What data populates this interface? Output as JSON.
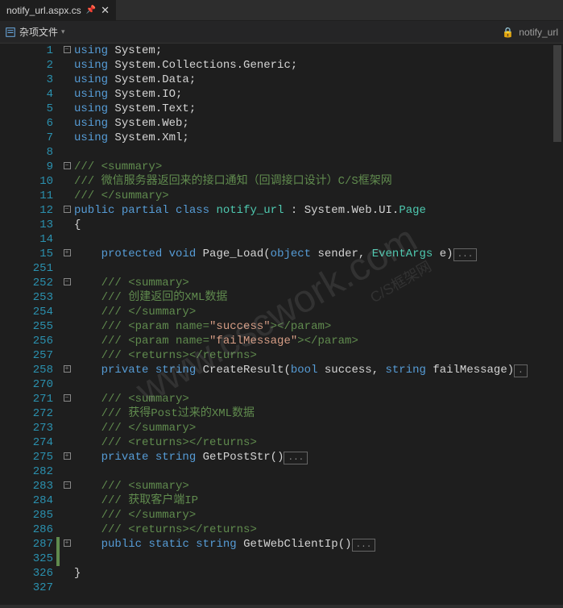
{
  "tab": {
    "title": "notify_url.aspx.cs"
  },
  "subbar": {
    "misc": "杂项文件",
    "right": "notify_url"
  },
  "watermark": "www.cscwork.com",
  "watermark_sub": "C/S框架网",
  "lines": [
    {
      "n": "1",
      "fold": "-",
      "html": "<span class='kw'>using</span> System;"
    },
    {
      "n": "2",
      "fold": "",
      "html": "<span class='kw'>using</span> System.Collections.Generic;"
    },
    {
      "n": "3",
      "fold": "",
      "html": "<span class='kw'>using</span> System.Data;"
    },
    {
      "n": "4",
      "fold": "",
      "html": "<span class='kw'>using</span> System.IO;"
    },
    {
      "n": "5",
      "fold": "",
      "html": "<span class='kw'>using</span> System.Text;"
    },
    {
      "n": "6",
      "fold": "",
      "html": "<span class='kw'>using</span> System.Web;"
    },
    {
      "n": "7",
      "fold": "",
      "html": "<span class='kw'>using</span> System.Xml;"
    },
    {
      "n": "8",
      "fold": "",
      "html": ""
    },
    {
      "n": "9",
      "fold": "-",
      "html": "<span class='comment'>/// &lt;summary&gt;</span>"
    },
    {
      "n": "10",
      "fold": "",
      "html": "<span class='comment'>/// 微信服务器返回来的接口通知（回调接口设计）C/S框架网</span>"
    },
    {
      "n": "11",
      "fold": "",
      "html": "<span class='comment'>/// &lt;/summary&gt;</span>"
    },
    {
      "n": "12",
      "fold": "-",
      "html": "<span class='kw'>public</span> <span class='kw'>partial</span> <span class='kw'>class</span> <span class='type'>notify_url</span> : System.Web.UI.<span class='type'>Page</span>"
    },
    {
      "n": "13",
      "fold": "",
      "html": "{"
    },
    {
      "n": "14",
      "fold": "",
      "html": ""
    },
    {
      "n": "15",
      "fold": "+",
      "html": "    <span class='kw'>protected</span> <span class='kw'>void</span> Page_Load(<span class='kw'>object</span> sender, <span class='type'>EventArgs</span> e)<span class='collapsed-box'>...</span>"
    },
    {
      "n": "251",
      "fold": "",
      "html": ""
    },
    {
      "n": "252",
      "fold": "-",
      "html": "    <span class='comment'>/// &lt;summary&gt;</span>"
    },
    {
      "n": "253",
      "fold": "",
      "html": "    <span class='comment'>/// 创建返回的XML数据</span>"
    },
    {
      "n": "254",
      "fold": "",
      "html": "    <span class='comment'>/// &lt;/summary&gt;</span>"
    },
    {
      "n": "255",
      "fold": "",
      "html": "    <span class='comment'>/// &lt;param name=</span><span class='str'>\"success\"</span><span class='comment'>&gt;&lt;/param&gt;</span>"
    },
    {
      "n": "256",
      "fold": "",
      "html": "    <span class='comment'>/// &lt;param name=</span><span class='str'>\"failMessage\"</span><span class='comment'>&gt;&lt;/param&gt;</span>"
    },
    {
      "n": "257",
      "fold": "",
      "html": "    <span class='comment'>/// &lt;returns&gt;&lt;/returns&gt;</span>"
    },
    {
      "n": "258",
      "fold": "+",
      "html": "    <span class='kw'>private</span> <span class='kw'>string</span> CreateResult(<span class='kw'>bool</span> success, <span class='kw'>string</span> failMessage)<span class='collapsed-box'>.</span>"
    },
    {
      "n": "270",
      "fold": "",
      "html": ""
    },
    {
      "n": "271",
      "fold": "-",
      "html": "    <span class='comment'>/// &lt;summary&gt;</span>"
    },
    {
      "n": "272",
      "fold": "",
      "html": "    <span class='comment'>/// 获得Post过来的XML数据</span>"
    },
    {
      "n": "273",
      "fold": "",
      "html": "    <span class='comment'>/// &lt;/summary&gt;</span>"
    },
    {
      "n": "274",
      "fold": "",
      "html": "    <span class='comment'>/// &lt;returns&gt;&lt;/returns&gt;</span>"
    },
    {
      "n": "275",
      "fold": "+",
      "html": "    <span class='kw'>private</span> <span class='kw'>string</span> GetPostStr()<span class='collapsed-box'>...</span>"
    },
    {
      "n": "282",
      "fold": "",
      "html": ""
    },
    {
      "n": "283",
      "fold": "-",
      "html": "    <span class='comment'>/// &lt;summary&gt;</span>"
    },
    {
      "n": "284",
      "fold": "",
      "html": "    <span class='comment'>/// 获取客户端IP</span>"
    },
    {
      "n": "285",
      "fold": "",
      "html": "    <span class='comment'>/// &lt;/summary&gt;</span>"
    },
    {
      "n": "286",
      "fold": "",
      "html": "    <span class='comment'>/// &lt;returns&gt;&lt;/returns&gt;</span>"
    },
    {
      "n": "287",
      "fold": "+",
      "chg": true,
      "html": "    <span class='kw'>public</span> <span class='kw'>static</span> <span class='kw'>string</span> GetWebClientIp()<span class='collapsed-box'>...</span>"
    },
    {
      "n": "325",
      "fold": "",
      "chg": true,
      "html": ""
    },
    {
      "n": "326",
      "fold": "",
      "html": "}"
    },
    {
      "n": "327",
      "fold": "",
      "html": ""
    }
  ]
}
